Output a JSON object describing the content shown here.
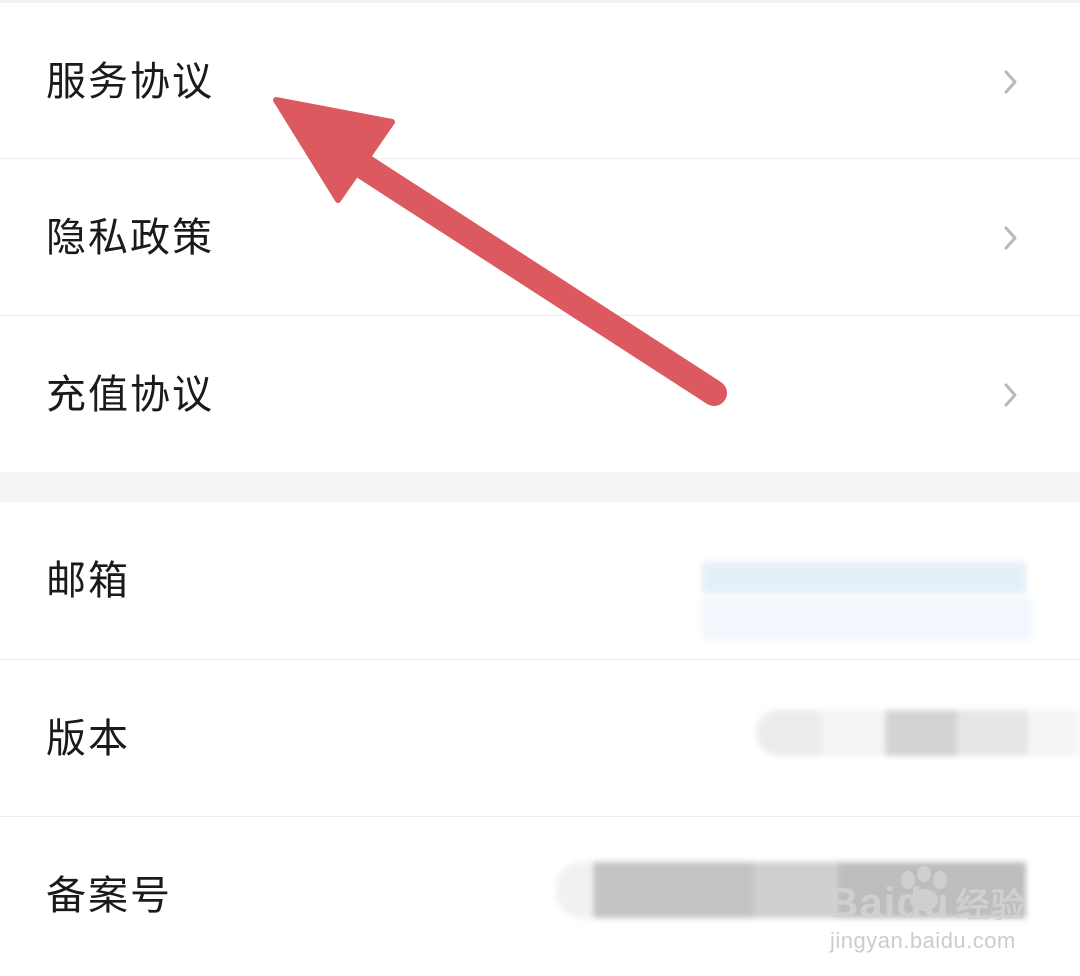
{
  "settings": {
    "items": [
      {
        "label": "服务协议",
        "has_chevron": true
      },
      {
        "label": "隐私政策",
        "has_chevron": true
      },
      {
        "label": "充值协议",
        "has_chevron": true
      },
      {
        "label": "邮箱",
        "value": "",
        "value_state": "blurred"
      },
      {
        "label": "版本",
        "value": "",
        "value_state": "blurred"
      },
      {
        "label": "备案号",
        "value": "",
        "value_state": "blurred"
      }
    ]
  },
  "annotation": {
    "type": "arrow",
    "color": "#dc5a5f",
    "points_to": "服务协议"
  },
  "watermark": {
    "brand": "Baidu",
    "brand_cn": "经验",
    "url": "jingyan.baidu.com"
  },
  "colors": {
    "background": "#ffffff",
    "section_gap": "#f5f5f5",
    "divider": "#ececec",
    "chevron": "#b8b8b8"
  },
  "icons": {
    "row_action": "chevron-right-icon"
  }
}
